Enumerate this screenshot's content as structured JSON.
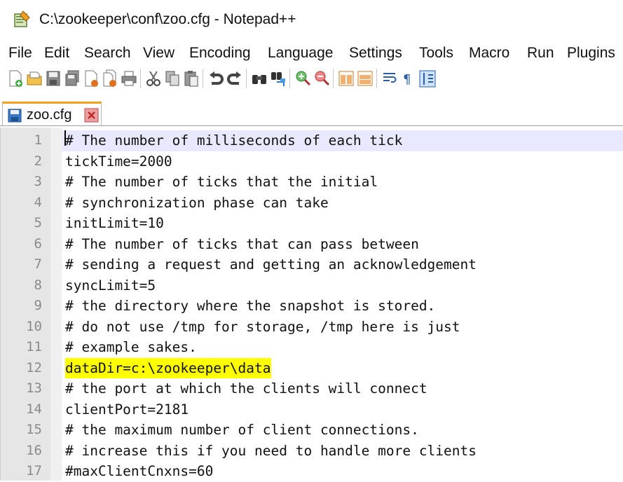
{
  "window": {
    "title": "C:\\zookeeper\\conf\\zoo.cfg - Notepad++"
  },
  "menu": [
    "File",
    "Edit",
    "Search",
    "View",
    "Encoding",
    "Language",
    "Settings",
    "Tools",
    "Macro",
    "Run",
    "Plugins"
  ],
  "toolbar_icons": [
    "new-file-icon",
    "open-file-icon",
    "save-icon",
    "save-all-icon",
    "close-icon",
    "close-all-icon",
    "print-icon",
    "cut-icon",
    "copy-icon",
    "paste-icon",
    "undo-icon",
    "redo-icon",
    "find-icon",
    "replace-icon",
    "zoom-in-icon",
    "zoom-out-icon",
    "sync-vertical-icon",
    "sync-horizontal-icon",
    "word-wrap-icon",
    "show-all-characters-icon",
    "indent-guide-icon"
  ],
  "tab": {
    "label": "zoo.cfg"
  },
  "colors": {
    "tab_accent": "#f7a11a",
    "highlight": "#ffff00",
    "current_line": "#e8e8ff",
    "gutter": "#e6e6e6"
  },
  "lines": [
    {
      "number": "1",
      "text": "# The number of milliseconds of each tick",
      "current": true
    },
    {
      "number": "2",
      "text": "tickTime=2000"
    },
    {
      "number": "3",
      "text": "# The number of ticks that the initial"
    },
    {
      "number": "4",
      "text": "# synchronization phase can take"
    },
    {
      "number": "5",
      "text": "initLimit=10"
    },
    {
      "number": "6",
      "text": "# The number of ticks that can pass between"
    },
    {
      "number": "7",
      "text": "# sending a request and getting an acknowledgement"
    },
    {
      "number": "8",
      "text": "syncLimit=5"
    },
    {
      "number": "9",
      "text": "# the directory where the snapshot is stored."
    },
    {
      "number": "10",
      "text": "# do not use /tmp for storage, /tmp here is just"
    },
    {
      "number": "11",
      "text": "# example sakes."
    },
    {
      "number": "12",
      "text": "dataDir=c:\\zookeeper\\data",
      "highlighted": true
    },
    {
      "number": "13",
      "text": "# the port at which the clients will connect"
    },
    {
      "number": "14",
      "text": "clientPort=2181"
    },
    {
      "number": "15",
      "text": "# the maximum number of client connections."
    },
    {
      "number": "16",
      "text": "# increase this if you need to handle more clients"
    },
    {
      "number": "17",
      "text": "#maxClientCnxns=60"
    }
  ]
}
